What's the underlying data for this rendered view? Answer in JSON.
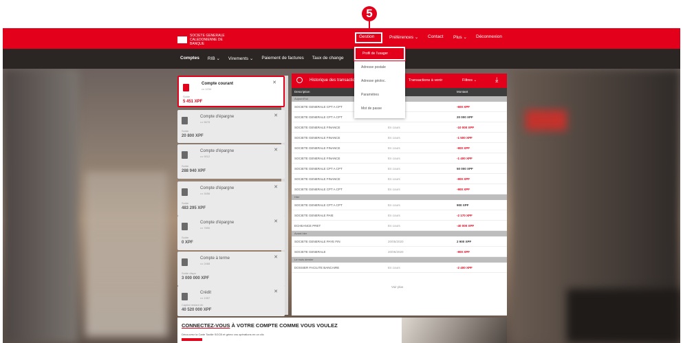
{
  "step_badge": "5",
  "colors": {
    "brand": "#e2001a",
    "subnav": "#2b2624"
  },
  "header": {
    "logo_text": "SOCIETE GENERALE CALEDONIENNE DE BANQUE",
    "nav": [
      "Gestion",
      "Préférences ⌄",
      "Contact",
      "Plus ⌄",
      "Déconnexion"
    ]
  },
  "subnav": [
    "Comptes",
    "RIB ⌄",
    "Virements ⌄",
    "Paiement de factures",
    "Taux de change"
  ],
  "dropdown": [
    "Profil de l'usager",
    "Adresse postale",
    "Adresse géoloc.",
    "Paramètres",
    "Mot de passe"
  ],
  "accounts": [
    {
      "name": "Compte courant",
      "sub": "••• 1234",
      "label": "Solde",
      "amount": "5 451 XPF"
    },
    {
      "name": "Compte d'épargne",
      "sub": "••• 5678",
      "label": "Solde",
      "amount": "20 800 XPF"
    },
    {
      "name": "Compte d'épargne",
      "sub": "••• 9012",
      "label": "Solde",
      "amount": "288 940 XPF"
    },
    {
      "name": "Compte d'épargne",
      "sub": "••• 3456",
      "label": "Solde",
      "amount": "483 295 XPF"
    },
    {
      "name": "Compte d'épargne",
      "sub": "••• 7890",
      "label": "Solde",
      "amount": "0 XPF"
    },
    {
      "name": "Compte à terme",
      "sub": "••• 2468",
      "label": "Solde dispo",
      "amount": "3 000 000 XPF"
    },
    {
      "name": "Crédit",
      "sub": "••• 1357",
      "label": "Capital restant dû",
      "amount": "40 520 000 XPF"
    }
  ],
  "panel": {
    "title": "Historique des transactions",
    "right1": "Transactions à venir",
    "right2": "Filtres ⌄",
    "col_desc": "Description",
    "col_amount": "Montant",
    "groups": [
      {
        "label": "Aujourd'hui",
        "rows": [
          {
            "desc": "SOCIETE GENERALE CPT A CPT",
            "cat": "En cours",
            "amt": "-600 XPF",
            "pos": false
          },
          {
            "desc": "SOCIETE GENERALE CPT A CPT",
            "cat": "En cours",
            "amt": "20 000 XPF",
            "pos": true
          },
          {
            "desc": "SOCIETE GENERALE FINANCE",
            "cat": "En cours",
            "amt": "-10 000 XPF",
            "pos": false
          },
          {
            "desc": "SOCIETE GENERALE FINANCE",
            "cat": "En cours",
            "amt": "-1 500 XPF",
            "pos": false
          },
          {
            "desc": "SOCIETE GENERALE FINANCE",
            "cat": "En cours",
            "amt": "-900 XPF",
            "pos": false
          },
          {
            "desc": "SOCIETE GENERALE FINANCE",
            "cat": "En cours",
            "amt": "-1 400 XPF",
            "pos": false
          },
          {
            "desc": "SOCIETE GENERALE CPT A CPT",
            "cat": "En cours",
            "amt": "50 000 XPF",
            "pos": true
          },
          {
            "desc": "SOCIETE GENERALE FINANCE",
            "cat": "En cours",
            "amt": "-900 XPF",
            "pos": false
          },
          {
            "desc": "SOCIETE GENERALE CPT A CPT",
            "cat": "En cours",
            "amt": "-900 XPF",
            "pos": false
          }
        ]
      },
      {
        "label": "Hier",
        "rows": [
          {
            "desc": "SOCIETE GENERALE CPT A CPT",
            "cat": "En cours",
            "amt": "900 XPF",
            "pos": true
          },
          {
            "desc": "SOCIETE GENERALE PAIE",
            "cat": "En cours",
            "amt": "-2 170 XPF",
            "pos": false
          },
          {
            "desc": "ECHEANCE PRET",
            "cat": "En cours",
            "amt": "-40 000 XPF",
            "pos": false
          }
        ]
      },
      {
        "label": "Avant-hier",
        "rows": [
          {
            "desc": "SOCIETE GENERALE PAYE FIN",
            "cat": "20/05/2020",
            "amt": "2 900 XPF",
            "pos": true
          },
          {
            "desc": "SOCIETE GENERALE",
            "cat": "20/05/2020",
            "amt": "-900 XPF",
            "pos": false
          }
        ]
      },
      {
        "label": "Le mois dernier",
        "rows": [
          {
            "desc": "DOSSIER FACILITE BANCAIRE",
            "cat": "En cours",
            "amt": "-2 400 XPF",
            "pos": false
          }
        ]
      }
    ],
    "see_all": "Voir plus"
  },
  "banner": {
    "title_underlined": "CONNECTEZ-VOUS",
    "title_rest": " À VOTRE COMPTE COMME VOUS VOULEZ",
    "subtitle": "Découvrez la Carte Tactile SGCB et gérez vos opérations en un clic"
  }
}
